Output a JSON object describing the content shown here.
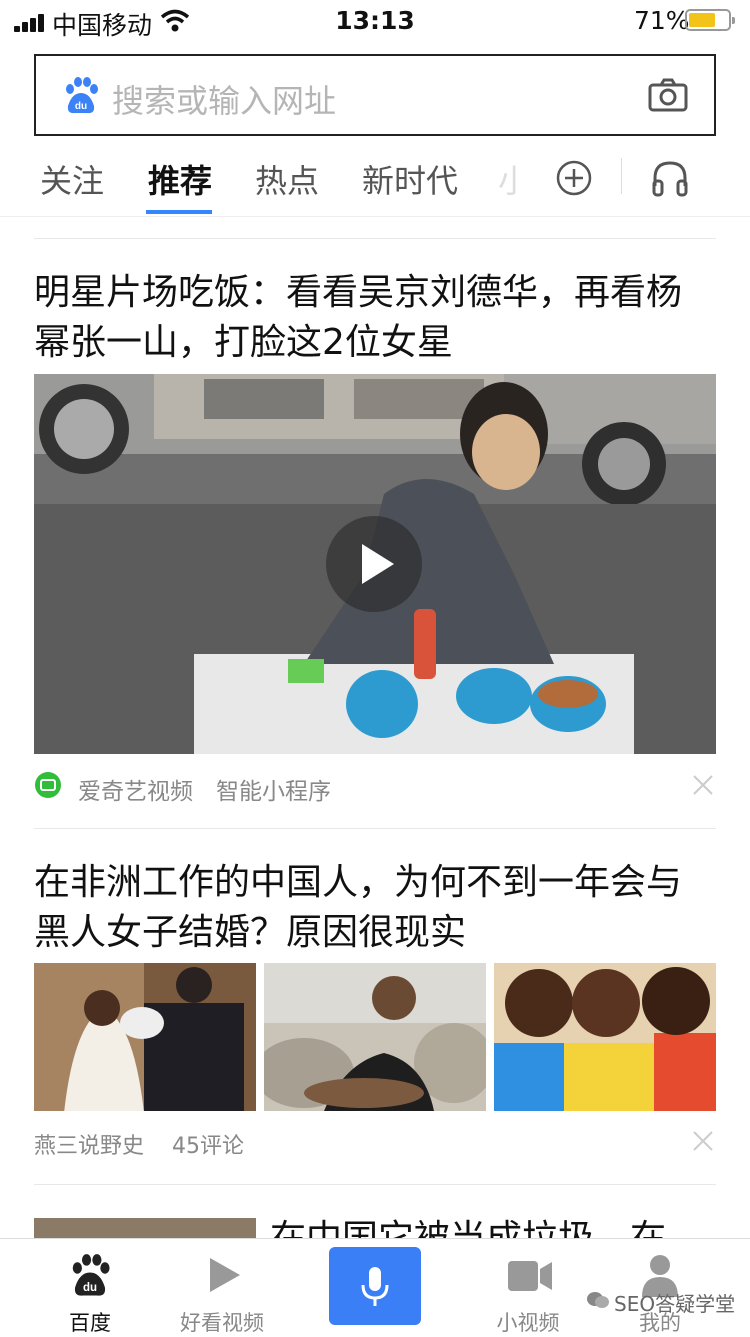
{
  "status": {
    "carrier": "中国移动",
    "time": "13:13",
    "battery": "71%",
    "battery_level": 0.71
  },
  "search": {
    "placeholder": "搜索或输入网址"
  },
  "tabs": [
    {
      "label": "关注"
    },
    {
      "label": "推荐"
    },
    {
      "label": "热点"
    },
    {
      "label": "新时代"
    },
    {
      "label": "小"
    }
  ],
  "articles": [
    {
      "title": "明星片场吃饭：看看吴京刘德华，再看杨幂张一山，打脸这2位女星",
      "source": "爱奇艺视频",
      "tag": "智能小程序"
    },
    {
      "title": "在非洲工作的中国人，为何不到一年会与黑人女子结婚？原因很现实",
      "source": "燕三说野史",
      "comments": "45评论"
    },
    {
      "title": "在中国它被当成垃圾，在"
    }
  ],
  "bottom_nav": [
    {
      "label": "百度"
    },
    {
      "label": "好看视频"
    },
    {
      "label": "小视频"
    },
    {
      "label": "我的"
    }
  ],
  "watermark": "SEO答疑学堂",
  "colors": {
    "accent": "#3388ff",
    "mic": "#3a7ff5",
    "battery": "#f2c318",
    "iqiyi": "#2fbd3a"
  }
}
